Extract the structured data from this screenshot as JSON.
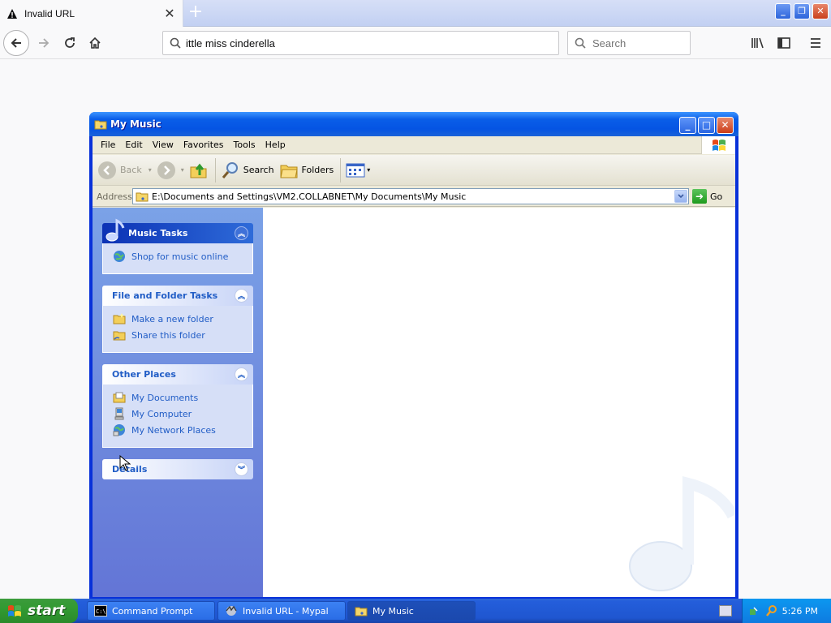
{
  "browser": {
    "tab_title": "Invalid URL",
    "url_text": "ittle miss cinderella",
    "search_placeholder": "Search"
  },
  "window": {
    "title": "My Music",
    "menu": [
      "File",
      "Edit",
      "View",
      "Favorites",
      "Tools",
      "Help"
    ],
    "toolbar": {
      "back": "Back",
      "search": "Search",
      "folders": "Folders"
    },
    "address": {
      "label": "Address",
      "path": "E:\\Documents and Settings\\VM2.COLLABNET\\My Documents\\My Music",
      "go": "Go"
    },
    "taskpane": {
      "music_tasks": {
        "title": "Music Tasks",
        "items": [
          "Shop for music online"
        ]
      },
      "file_folder_tasks": {
        "title": "File and Folder Tasks",
        "items": [
          "Make a new folder",
          "Share this folder"
        ]
      },
      "other_places": {
        "title": "Other Places",
        "items": [
          "My Documents",
          "My Computer",
          "My Network Places"
        ]
      },
      "details": {
        "title": "Details"
      }
    }
  },
  "taskbar": {
    "start": "start",
    "tasks": [
      "Command Prompt",
      "Invalid URL - Mypal",
      "My Music"
    ],
    "clock": "5:26 PM"
  }
}
